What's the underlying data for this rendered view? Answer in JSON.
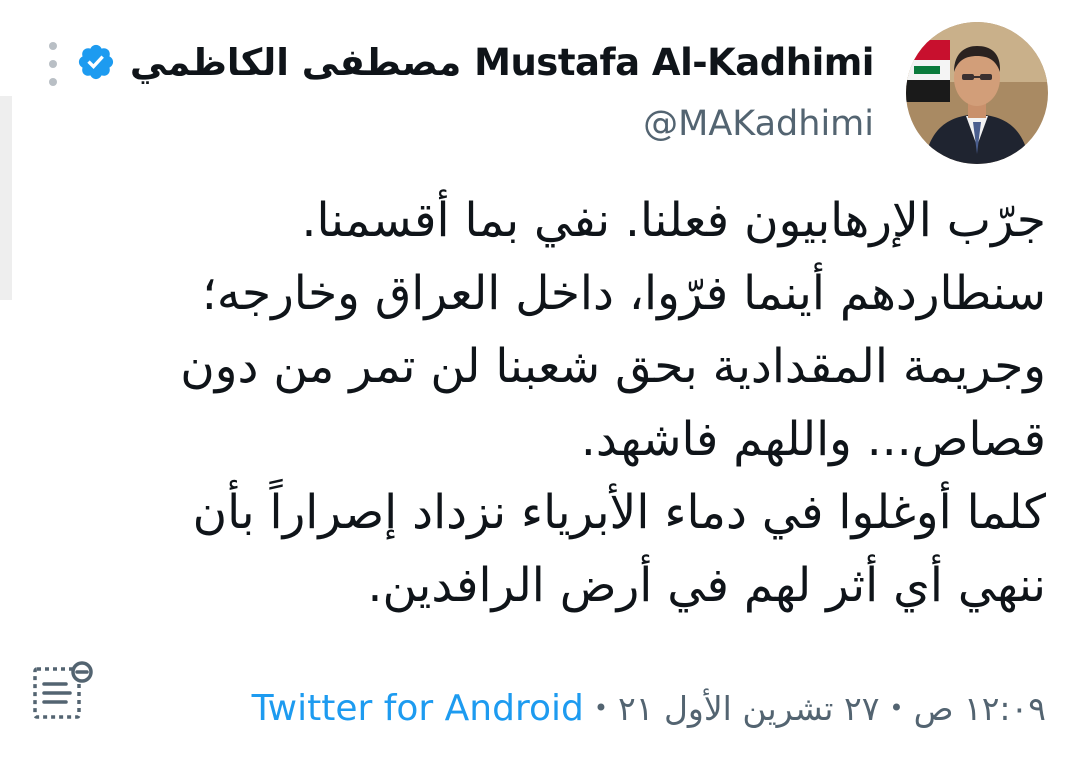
{
  "author": {
    "display_name": "مصطفى الكاظمي Mustafa Al-Kadhimi",
    "handle": "@MAKadhimi",
    "verified": true
  },
  "tweet": {
    "lines": [
      "جرّب الإرهابيون فعلنا. نفي بما أقسمنا.",
      "سنطاردهم أينما فرّوا، داخل العراق وخارجه؛",
      "وجريمة المقدادية بحق شعبنا لن تمر من دون",
      "قصاص... واللهم فاشهد.",
      "كلما أوغلوا في دماء الأبرياء نزداد إصراراً بأن",
      "ننهي أي أثر لهم في أرض الرافدين."
    ]
  },
  "meta": {
    "time": "١٢:٠٩ ص",
    "date": "٢٧ تشرين الأول ٢١",
    "separator": "•",
    "source": "Twitter for Android"
  },
  "icons": {
    "more": "more-vertical-icon",
    "verified": "verified-badge-icon",
    "transcribe": "document-lines-icon"
  },
  "colors": {
    "link": "#1d9bf0",
    "verified": "#1d9bf0",
    "secondary_text": "#536471",
    "primary_text": "#0f1419"
  }
}
